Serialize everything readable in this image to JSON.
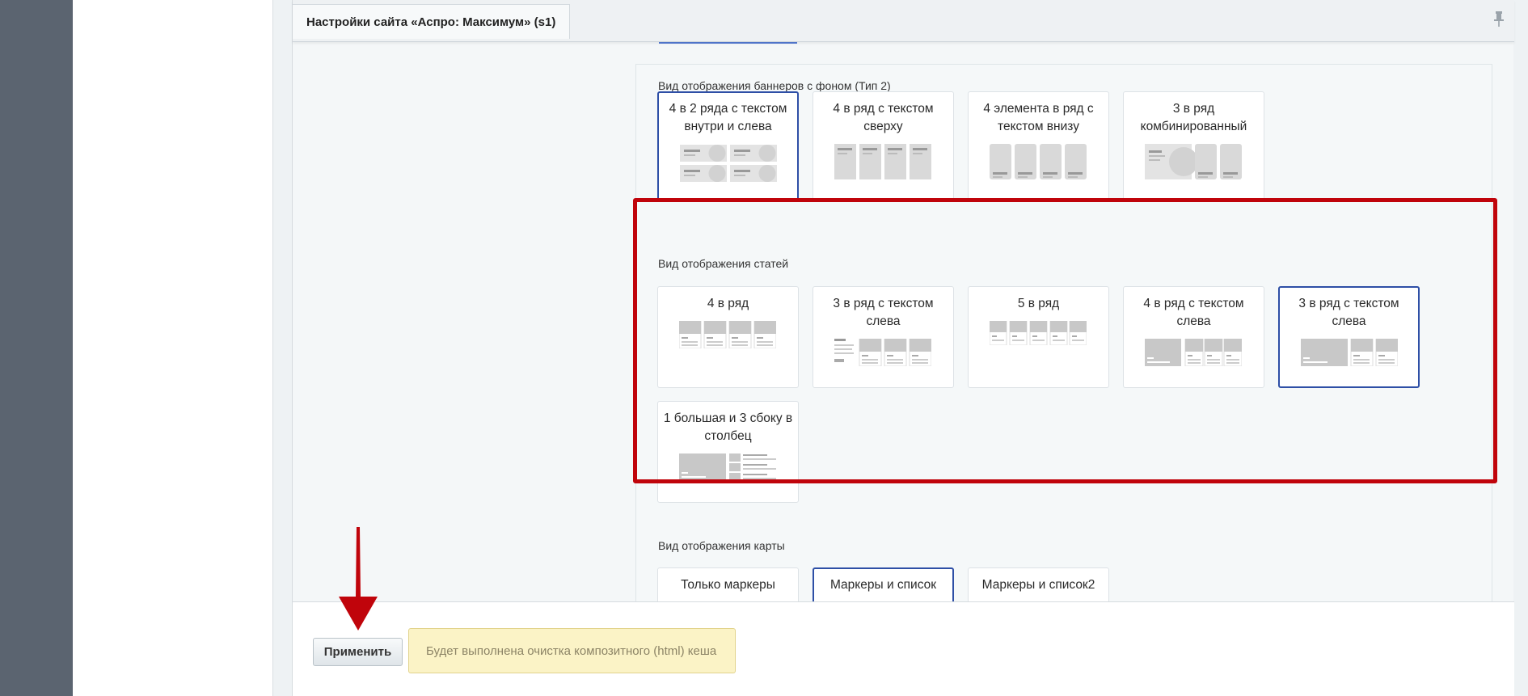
{
  "window": {
    "title": "Настройки сайта «Аспро: Максимум» (s1)",
    "pin_icon": "pin-icon"
  },
  "banners_section": {
    "title": "Вид отображения баннеров с фоном (Тип 2)",
    "options": [
      {
        "label": "4 в 2 ряда с текстом внутри и слева",
        "selected": true
      },
      {
        "label": "4 в ряд с текстом сверху",
        "selected": false
      },
      {
        "label": "4 элемента в ряд с текстом внизу",
        "selected": false
      },
      {
        "label": "3 в ряд комбинированный",
        "selected": false
      }
    ]
  },
  "articles_section": {
    "title": "Вид отображения статей",
    "options": [
      {
        "label": "4 в ряд",
        "selected": false
      },
      {
        "label": "3 в ряд с текстом слева",
        "selected": false
      },
      {
        "label": "5 в ряд",
        "selected": false
      },
      {
        "label": "4 в ряд с текстом слева",
        "selected": false
      },
      {
        "label": "3 в ряд с текстом слева",
        "selected": true
      },
      {
        "label": "1 большая и 3 сбоку в столбец",
        "selected": false
      }
    ]
  },
  "map_section": {
    "title": "Вид отображения карты",
    "options": [
      {
        "label": "Только маркеры",
        "selected": false
      },
      {
        "label": "Маркеры и список",
        "selected": true
      },
      {
        "label": "Маркеры и список2",
        "selected": false
      }
    ]
  },
  "footer": {
    "apply_label": "Применить",
    "notice": "Будет выполнена очистка композитного (html) кеша"
  },
  "colors": {
    "highlight": "#c0040b",
    "selected_border": "#2e4fa6",
    "arrow": "#c0040b"
  }
}
